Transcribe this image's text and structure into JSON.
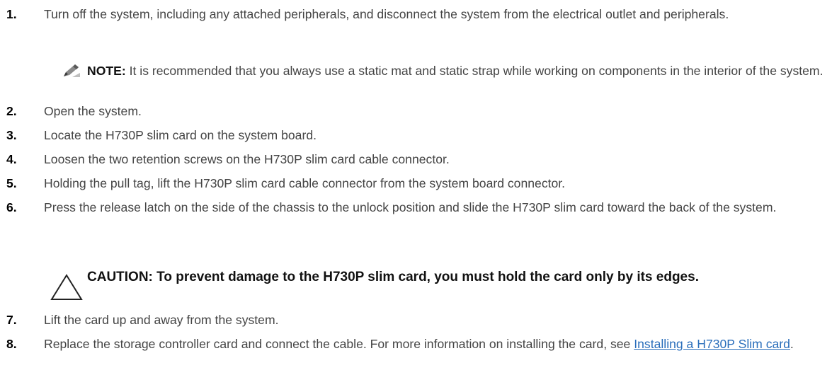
{
  "steps": [
    {
      "number": "1.",
      "text": "Turn off the system, including any attached peripherals, and disconnect the system from the electrical outlet and peripherals."
    },
    {
      "number": "2.",
      "text": "Open the system."
    },
    {
      "number": "3.",
      "text": "Locate the H730P slim card on the system board."
    },
    {
      "number": "4.",
      "text": "Loosen the two retention screws on the H730P slim card cable connector."
    },
    {
      "number": "5.",
      "text": "Holding the pull tag, lift the H730P slim card cable connector from the system board connector."
    },
    {
      "number": "6.",
      "text": "Press the release latch on the side of the chassis to the unlock position and slide the H730P slim card toward the back of the system."
    },
    {
      "number": "7.",
      "text": "Lift the card up and away from the system."
    },
    {
      "number": "8.",
      "text": "Replace the storage controller card and connect the cable. For more information on installing the card, see ",
      "link": "Installing a H730P Slim card",
      "suffix": "."
    }
  ],
  "note": {
    "icon": "pencil-note-icon",
    "label": "NOTE:",
    "text": " It is recommended that you always use a static mat and static strap while working on components in the interior of the system."
  },
  "caution": {
    "icon": "caution-triangle-icon",
    "text": "CAUTION: To prevent damage to the H730P slim card, you must hold the card only by its edges."
  },
  "colors": {
    "body_text": "#444444",
    "numbers": "#000000",
    "link": "#2a6ebb"
  }
}
